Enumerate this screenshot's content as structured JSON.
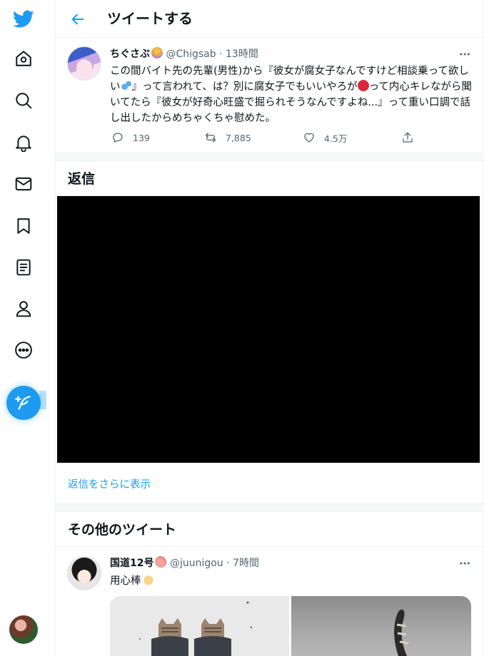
{
  "nav": {
    "items": [
      {
        "name": "twitter-logo",
        "icon": "twitter-bird-icon"
      },
      {
        "name": "home",
        "icon": "home-icon"
      },
      {
        "name": "explore",
        "icon": "search-icon"
      },
      {
        "name": "notifications",
        "icon": "bell-icon"
      },
      {
        "name": "messages",
        "icon": "mail-icon"
      },
      {
        "name": "bookmarks",
        "icon": "bookmark-icon"
      },
      {
        "name": "lists",
        "icon": "list-icon"
      },
      {
        "name": "profile",
        "icon": "person-icon"
      },
      {
        "name": "more",
        "icon": "more-circle-icon"
      }
    ],
    "compose_icon": "feather-plus-icon"
  },
  "header": {
    "title": "ツイートする",
    "back_icon": "arrow-left-icon"
  },
  "tweet": {
    "name": "ちぐさぶ",
    "handle": "@Chigsab",
    "dot": "·",
    "time": "13時間",
    "text_part1": "この間バイト先の先輩(男性)から『彼女が腐女子なんですけど相談乗って欲しい",
    "text_part2": "』って言われて、は？別に腐女子でもいいやろが",
    "text_part3": "って内心キレながら聞いてたら『彼女が好奇心旺盛で掘られそうなんですよね...』って重い口調で話し出したからめちゃくちゃ慰めた。",
    "stats": {
      "replies": "139",
      "retweets": "7,885",
      "likes": "4.5万"
    }
  },
  "replies_section": {
    "title": "返信",
    "show_more": "返信をさらに表示"
  },
  "more_tweets": {
    "title": "その他のツイート",
    "tweet": {
      "name": "国道12号",
      "handle": "@juunigou",
      "dot": "·",
      "time": "7時間",
      "text": "用心棒"
    }
  },
  "colors": {
    "accent": "#1d9bf0",
    "text": "#0f1419",
    "secondary": "#536471"
  }
}
